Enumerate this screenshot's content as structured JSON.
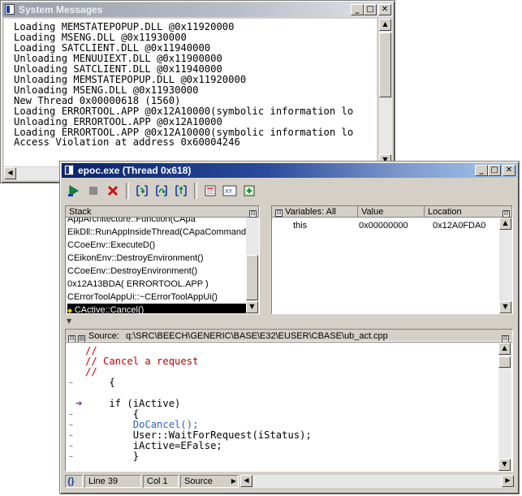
{
  "system_messages": {
    "title": "System Messages",
    "lines": [
      "Loading MEMSTATEPOPUP.DLL @0x11920000",
      "Loading MSENG.DLL @0x11930000",
      "Loading SATCLIENT.DLL @0x11940000",
      "Unloading MENUUIEXT.DLL @0x11900000",
      "Unloading SATCLIENT.DLL @0x11940000",
      "Unloading MEMSTATEPOPUP.DLL @0x11920000",
      "Unloading MSENG.DLL @0x11930000",
      "New Thread 0x00000618 (1560)",
      "Loading ERRORTOOL.APP @0x12A10000(symbolic information lo",
      "Unloading ERRORTOOL.APP @0x12A10000",
      "Loading ERRORTOOL.APP @0x12A10000(symbolic information lo",
      "Access Violation at address 0x60004246"
    ]
  },
  "debugger": {
    "title": "epoc.exe (Thread 0x618)",
    "toolbar_icons": [
      "run-icon",
      "stop-icon",
      "kill-icon",
      "step-into-icon",
      "step-over-icon",
      "step-out-icon",
      "breakpoint-icon",
      "registers-icon",
      "memory-icon"
    ],
    "stack": {
      "header": "Stack",
      "items": [
        "AppArchitecture::Function(CApa",
        "EikDll::RunAppInsideThread(CApaCommand...",
        "CCoeEnv::ExecuteD()",
        "CEikonEnv::DestroyEnvironment()",
        "CCoeEnv::DestroyEnvironment()",
        "0x12A13BDA( ERRORTOOL.APP )",
        "CErrorToolAppUi::~CErrorToolAppUi()",
        "CActive::Cancel()"
      ]
    },
    "variables": {
      "header": "Variables: All",
      "columns": [
        "Value",
        "Location"
      ],
      "rows": [
        {
          "name": "this",
          "value": "0x00000000",
          "location": "0x12A0FDA0"
        }
      ]
    },
    "source": {
      "label": "Source:",
      "path": "q:\\SRC\\BEECH\\GENERIC\\BASE\\E32\\EUSER\\CBASE\\ub_act.cpp",
      "lines": [
        "//",
        "// Cancel a request",
        "//",
        "    {",
        "",
        "    if (iActive)",
        "        {",
        "        DoCancel();",
        "        User::WaitForRequest(iStatus);",
        "        iActive=EFalse;",
        "        }"
      ]
    },
    "status": {
      "line": "Line 39",
      "col": "Col 1",
      "mode": "Source"
    },
    "colors": {
      "comment": "#c00000",
      "call": "#3060c0",
      "title_active": "#0a246a",
      "window_bg": "#d4d0c8"
    }
  }
}
